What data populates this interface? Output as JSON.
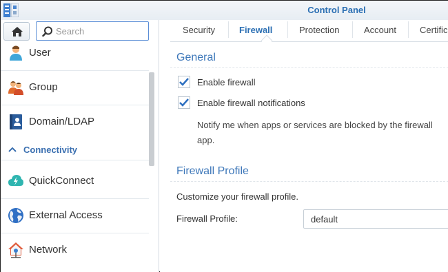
{
  "window": {
    "title": "Control Panel"
  },
  "search": {
    "placeholder": "Search"
  },
  "sidebar": {
    "items": [
      {
        "label": "User"
      },
      {
        "label": "Group"
      },
      {
        "label": "Domain/LDAP"
      }
    ],
    "section": {
      "label": "Connectivity"
    },
    "connectivity_items": [
      {
        "label": "QuickConnect"
      },
      {
        "label": "External Access"
      },
      {
        "label": "Network"
      }
    ]
  },
  "tabs": [
    {
      "label": "Security"
    },
    {
      "label": "Firewall",
      "active": true
    },
    {
      "label": "Protection"
    },
    {
      "label": "Account"
    },
    {
      "label": "Certific"
    }
  ],
  "general": {
    "title": "General",
    "enable_firewall": {
      "label": "Enable firewall",
      "checked": true
    },
    "enable_notifications": {
      "label": "Enable firewall notifications",
      "checked": true
    },
    "note": "Notify me when apps or services are blocked by the firewall app."
  },
  "profile": {
    "title": "Firewall Profile",
    "description": "Customize your firewall profile.",
    "field_label": "Firewall Profile:",
    "value": "default"
  },
  "colors": {
    "accent": "#2b6fb3",
    "check": "#2d6fc0"
  }
}
